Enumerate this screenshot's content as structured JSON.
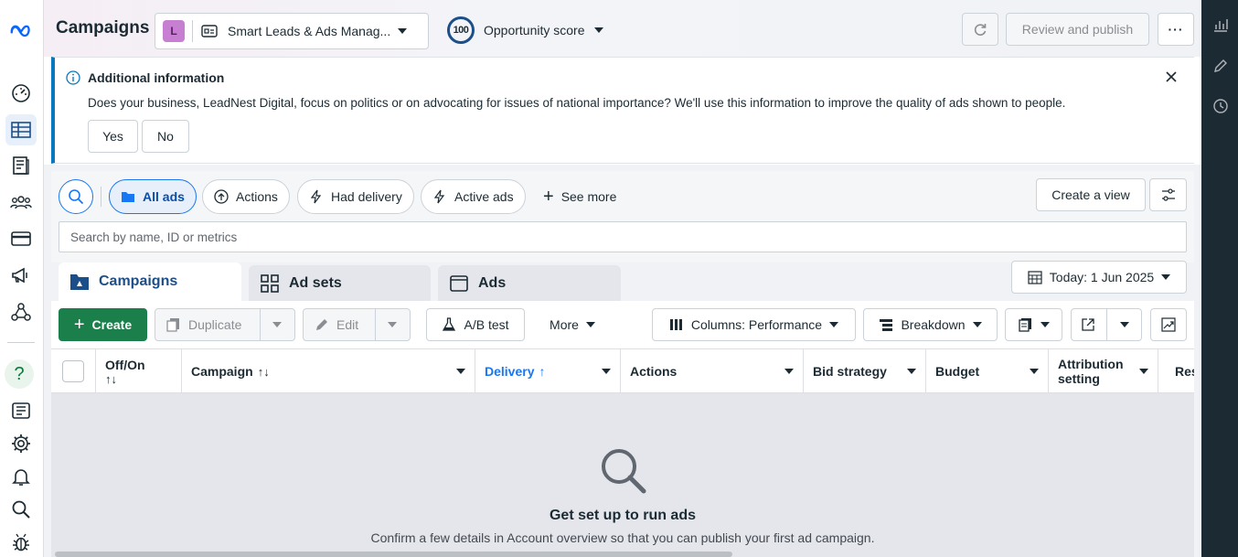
{
  "header": {
    "title": "Campaigns",
    "account_initial": "L",
    "account_name": "Smart Leads & Ads Manag...",
    "opportunity_score": "100",
    "opportunity_label": "Opportunity score",
    "review_publish": "Review and publish"
  },
  "banner": {
    "title": "Additional information",
    "text": "Does your business, LeadNest Digital, focus on politics or on advocating for issues of national importance? We'll use this information to improve the quality of ads shown to people.",
    "yes": "Yes",
    "no": "No"
  },
  "filters": {
    "all_ads": "All ads",
    "actions": "Actions",
    "had_delivery": "Had delivery",
    "active_ads": "Active ads",
    "see_more": "See more",
    "create_view": "Create a view"
  },
  "search": {
    "placeholder": "Search by name, ID or metrics"
  },
  "tabs": {
    "campaigns": "Campaigns",
    "ad_sets": "Ad sets",
    "ads": "Ads"
  },
  "date_range": "Today: 1 Jun 2025",
  "toolbar": {
    "create": "Create",
    "duplicate": "Duplicate",
    "edit": "Edit",
    "ab_test": "A/B test",
    "more": "More",
    "columns": "Columns: Performance",
    "breakdown": "Breakdown"
  },
  "table": {
    "columns": {
      "off_on": "Off/On",
      "campaign": "Campaign",
      "delivery": "Delivery",
      "actions": "Actions",
      "bid_strategy": "Bid strategy",
      "budget": "Budget",
      "attribution_1": "Attribution",
      "attribution_2": "setting",
      "results": "Res"
    }
  },
  "empty_state": {
    "title": "Get set up to run ads",
    "subtitle": "Confirm a few details in Account overview so that you can publish your first ad campaign."
  },
  "colors": {
    "primary": "#1877f2",
    "create_green": "#1a7f4b",
    "rail_dark": "#1c2b33",
    "banner_accent": "#0a78be"
  },
  "icons": {
    "left_nav": [
      "meta-logo-icon",
      "gauge-icon",
      "table-icon",
      "pages-icon",
      "audience-icon",
      "billing-icon",
      "megaphone-icon",
      "network-icon",
      "help-icon",
      "notebook-icon",
      "gear-icon",
      "bell-icon",
      "search-icon",
      "bug-icon"
    ],
    "right_rail": [
      "chart-icon",
      "pencil-icon",
      "history-icon"
    ]
  }
}
